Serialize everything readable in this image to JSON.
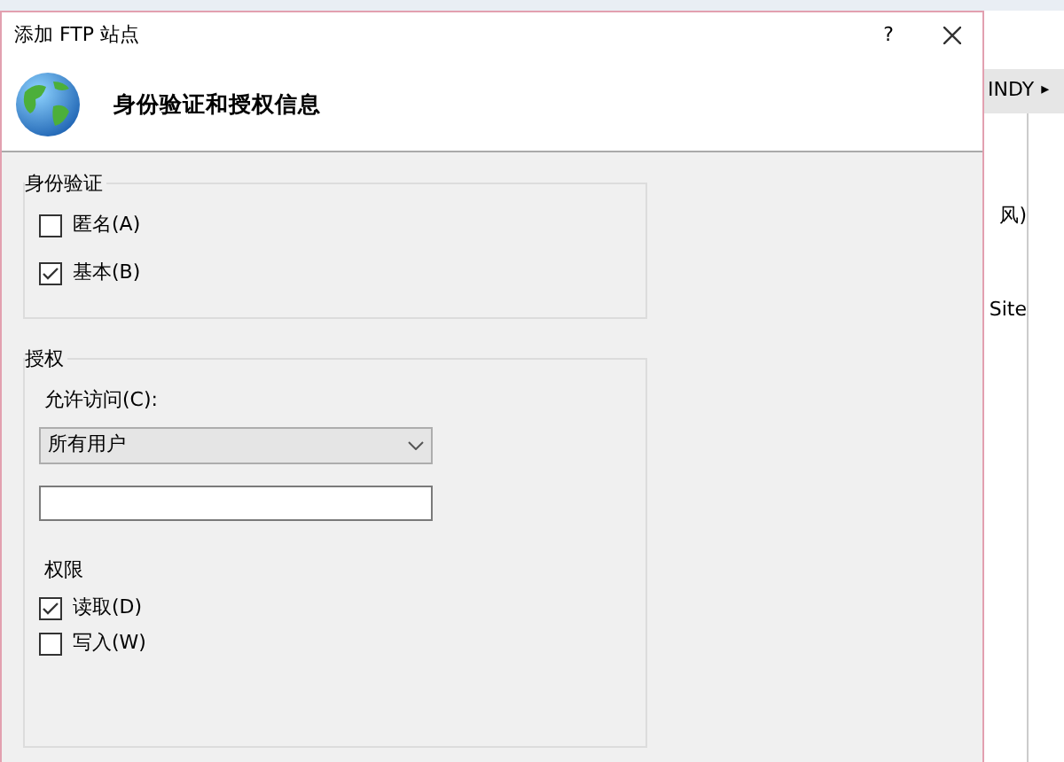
{
  "window": {
    "title": "添加 FTP 站点",
    "help": "?"
  },
  "header": {
    "title": "身份验证和授权信息"
  },
  "authentication": {
    "legend": "身份验证",
    "options": [
      {
        "label": "匿名(A)",
        "checked": false
      },
      {
        "label": "基本(B)",
        "checked": true
      }
    ]
  },
  "authorization": {
    "legend": "授权",
    "access_label": "允许访问(C):",
    "access_value": "所有用户",
    "permissions_label": "权限",
    "permissions": [
      {
        "label": "读取(D)",
        "checked": true
      },
      {
        "label": "写入(W)",
        "checked": false
      }
    ]
  },
  "background": {
    "breadcrumb": "INDY",
    "breadcrumb_arrow": "▸",
    "items": [
      "风)",
      "Site"
    ]
  }
}
